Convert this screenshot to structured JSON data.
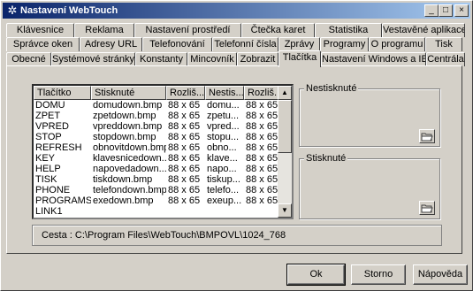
{
  "window": {
    "title": "Nastavení WebTouch",
    "min_label": "_",
    "max_label": "□",
    "close_label": "×"
  },
  "tabs": {
    "row1": [
      "Klávesnice",
      "Reklama",
      "Nastavení prostředí",
      "Čtečka karet",
      "Statistika",
      "Vestavěné aplikace"
    ],
    "row2": [
      "Správce oken",
      "Adresy URL",
      "Telefonování",
      "Telefonní čísla",
      "Zprávy",
      "Programy",
      "O programu",
      "Tisk"
    ],
    "row3": [
      "Obecné",
      "Systémové stránky",
      "Konstanty",
      "Mincovník",
      "Zobrazit",
      "Tlačítka",
      "Nastavení Windows a IE",
      "Centrála"
    ],
    "active": "Tlačítka"
  },
  "list": {
    "columns": [
      "Tlačítko",
      "Stisknuté",
      "Rozliš...",
      "Nestis...",
      "Rozliš..."
    ],
    "rows": [
      [
        "DOMU",
        "domudown.bmp",
        "88 x 65",
        "domu...",
        "88 x 65"
      ],
      [
        "ZPET",
        "zpetdown.bmp",
        "88 x 65",
        "zpetu...",
        "88 x 65"
      ],
      [
        "VPRED",
        "vpreddown.bmp",
        "88 x 65",
        "vpred...",
        "88 x 65"
      ],
      [
        "STOP",
        "stopdown.bmp",
        "88 x 65",
        "stopu...",
        "88 x 65"
      ],
      [
        "REFRESH",
        "obnovitdown.bmp",
        "88 x 65",
        "obno...",
        "88 x 65"
      ],
      [
        "KEY",
        "klavesnicedown....",
        "88 x 65",
        "klave...",
        "88 x 65"
      ],
      [
        "HELP",
        "napovedadown....",
        "88 x 65",
        "napo...",
        "88 x 65"
      ],
      [
        "TISK",
        "tiskdown.bmp",
        "88 x 65",
        "tiskup...",
        "88 x 65"
      ],
      [
        "PHONE",
        "telefondown.bmp",
        "88 x 65",
        "telefo...",
        "88 x 65"
      ],
      [
        "PROGRAMS",
        "exedown.bmp",
        "88 x 65",
        "exeup...",
        "88 x 65"
      ],
      [
        "LINK1",
        "",
        "",
        "",
        ""
      ],
      [
        "LINK2",
        "",
        "",
        "",
        ""
      ]
    ]
  },
  "groups": {
    "unpressed_label": "Nestisknuté",
    "pressed_label": "Stisknuté"
  },
  "status": {
    "path_text": "Cesta : C:\\Program Files\\WebTouch\\BMPOVL\\1024_768"
  },
  "buttons": {
    "ok": "Ok",
    "cancel": "Storno",
    "help": "Nápověda"
  },
  "icons": {
    "app": "gear-icon",
    "browse": "folder-icon"
  }
}
